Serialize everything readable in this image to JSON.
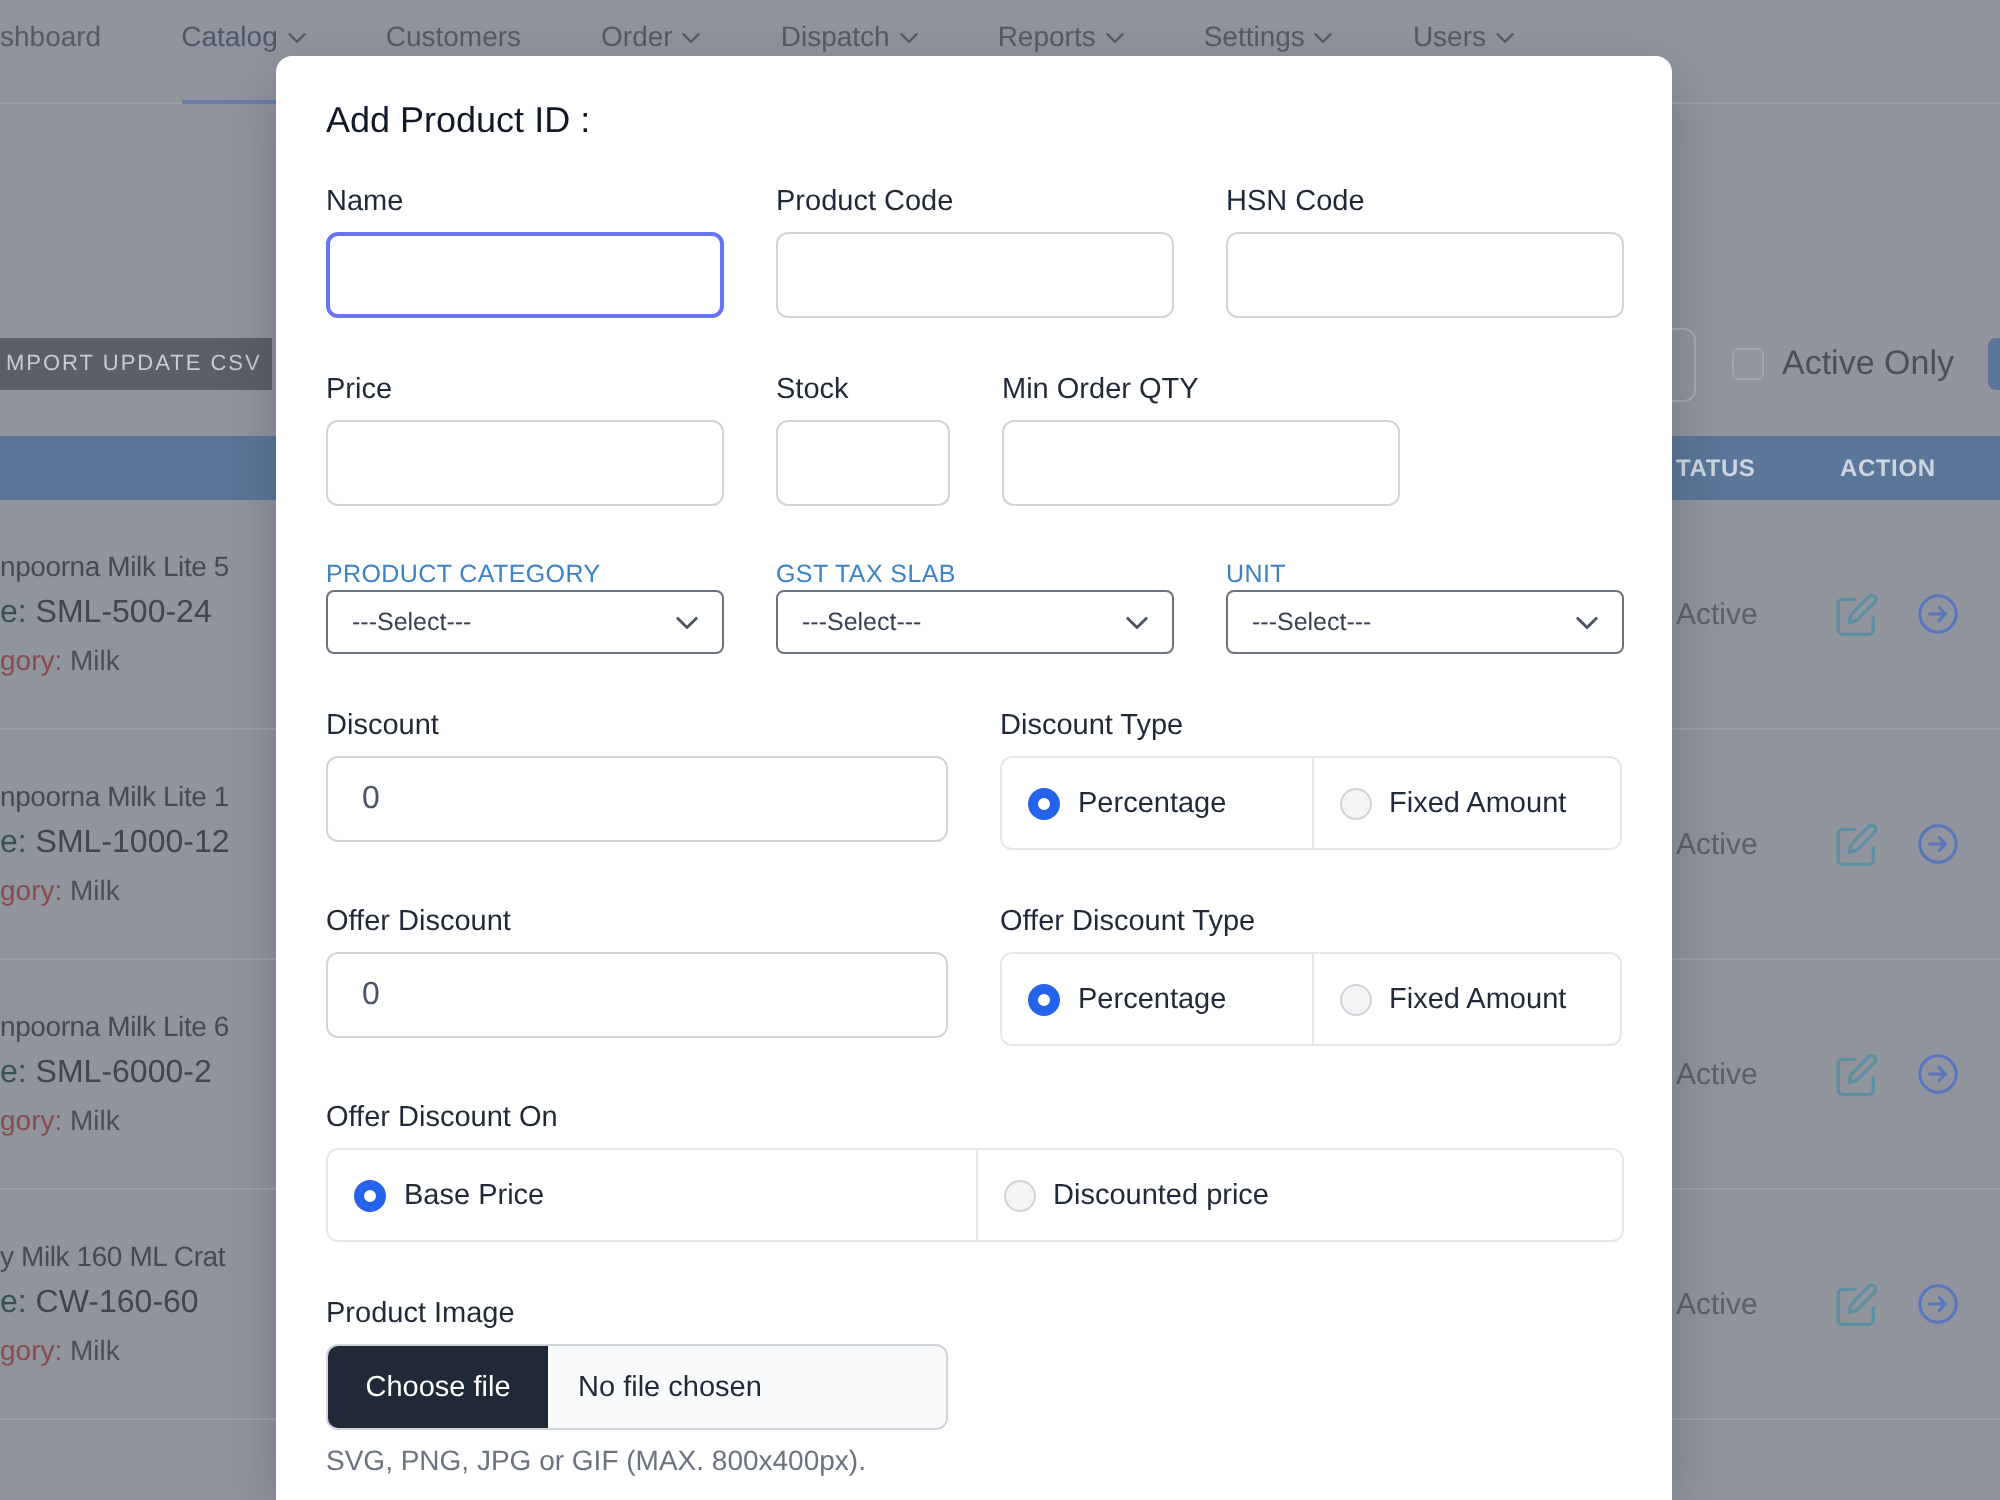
{
  "page": {
    "nav": [
      {
        "label": "shboard",
        "dropdown": false,
        "selected": false
      },
      {
        "label": "Catalog",
        "dropdown": true,
        "selected": true
      },
      {
        "label": "Customers",
        "dropdown": false,
        "selected": false
      },
      {
        "label": "Order",
        "dropdown": true,
        "selected": false
      },
      {
        "label": "Dispatch",
        "dropdown": true,
        "selected": false
      },
      {
        "label": "Reports",
        "dropdown": true,
        "selected": false
      },
      {
        "label": "Settings",
        "dropdown": true,
        "selected": false
      },
      {
        "label": "Users",
        "dropdown": true,
        "selected": false
      }
    ],
    "import_button": "MPORT UPDATE CSV",
    "active_only": {
      "label": "Active Only",
      "checked": false
    },
    "table": {
      "columns": [
        "TATUS",
        "ACTION"
      ],
      "rows": [
        {
          "name": "npoorna Milk Lite 5",
          "code_label": "e:",
          "code": "SML-500-24",
          "category_label": "gory:",
          "category": "Milk",
          "status": "Active"
        },
        {
          "name": "npoorna Milk Lite 1",
          "code_label": "e:",
          "code": "SML-1000-12",
          "category_label": "gory:",
          "category": "Milk",
          "status": "Active"
        },
        {
          "name": "npoorna Milk Lite 6",
          "code_label": "e:",
          "code": "SML-6000-2",
          "category_label": "gory:",
          "category": "Milk",
          "status": "Active"
        },
        {
          "name": "y Milk 160 ML Crat",
          "code_label": "e:",
          "code": "CW-160-60",
          "category_label": "gory:",
          "category": "Milk",
          "status": "Active"
        }
      ]
    }
  },
  "modal": {
    "title": "Add Product ID :",
    "rows": [
      {
        "fields": [
          {
            "kind": "text",
            "label": "Name",
            "focused": true
          },
          {
            "kind": "text",
            "label": "Product Code",
            "focused": false
          },
          {
            "kind": "text",
            "label": "HSN Code",
            "focused": false
          }
        ]
      },
      {
        "fields": [
          {
            "kind": "text",
            "label": "Price",
            "focused": false
          },
          {
            "kind": "text",
            "label": "Stock",
            "focused": false
          },
          {
            "kind": "text",
            "label": "Min Order QTY",
            "focused": false
          }
        ]
      },
      {
        "fields": [
          {
            "kind": "select",
            "label": "PRODUCT CATEGORY",
            "value": "---Select---"
          },
          {
            "kind": "select",
            "label": "GST TAX SLAB",
            "value": "---Select---"
          },
          {
            "kind": "select",
            "label": "UNIT",
            "value": "---Select---"
          }
        ]
      },
      {
        "fields": [
          {
            "kind": "text",
            "label": "Discount",
            "value": "0",
            "focused": false
          },
          {
            "kind": "radio",
            "label": "Discount Type",
            "options": [
              {
                "label": "Percentage",
                "selected": true
              },
              {
                "label": "Fixed Amount",
                "selected": false
              }
            ]
          }
        ]
      },
      {
        "fields": [
          {
            "kind": "text",
            "label": "Offer Discount",
            "value": "0",
            "focused": false
          },
          {
            "kind": "radio",
            "label": "Offer Discount Type",
            "options": [
              {
                "label": "Percentage",
                "selected": true
              },
              {
                "label": "Fixed Amount",
                "selected": false
              }
            ]
          }
        ]
      },
      {
        "fields": [
          {
            "kind": "radio",
            "label": "Offer Discount On",
            "options": [
              {
                "label": "Base Price",
                "selected": true
              },
              {
                "label": "Discounted price",
                "selected": false
              }
            ]
          }
        ]
      },
      {
        "fields": [
          {
            "kind": "file",
            "label": "Product Image",
            "button": "Choose file",
            "status": "No file chosen",
            "hint": "SVG, PNG, JPG or GIF (MAX. 800x400px)."
          }
        ]
      }
    ]
  }
}
